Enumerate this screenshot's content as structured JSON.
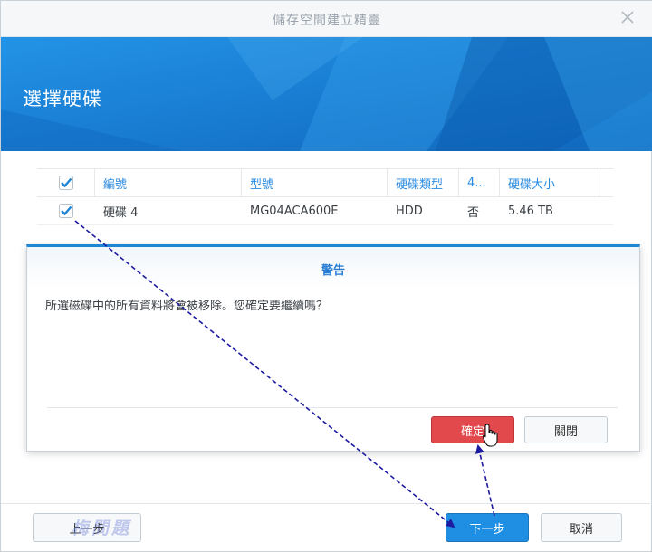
{
  "window": {
    "title": "儲存空間建立精靈"
  },
  "banner": {
    "title": "選擇硬碟"
  },
  "grid": {
    "columns": [
      "編號",
      "型號",
      "硬碟類型",
      "4...",
      "硬碟大小"
    ],
    "rows": [
      {
        "number": "硬碟 4",
        "model": "MG04ACA600E",
        "type": "HDD",
        "col4": "否",
        "size": "5.46 TB"
      }
    ]
  },
  "dialog": {
    "title": "警告",
    "message": "所選磁碟中的所有資料將會被移除。您確定要繼續嗎？",
    "confirm_label": "確定",
    "close_label": "關閉"
  },
  "footer": {
    "prev_label": "上一步",
    "next_label": "下一步",
    "cancel_label": "取消"
  },
  "watermark": "梅問題",
  "colors": {
    "accent": "#1f86d6",
    "danger": "#e2494d",
    "annotation": "#1d1ba0"
  }
}
